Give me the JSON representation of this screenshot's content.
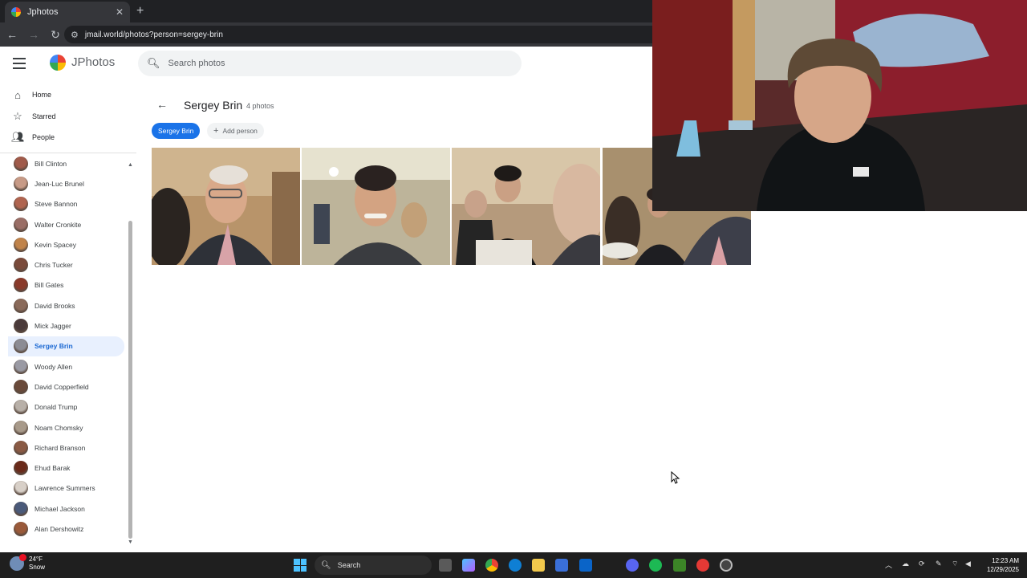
{
  "browser": {
    "tab_title": "Jphotos",
    "tab_close": "✕",
    "new_tab": "+",
    "url": "jmail.world/photos?person=sergey-brin"
  },
  "app": {
    "name": "JPhotos",
    "search_placeholder": "Search photos"
  },
  "nav": [
    {
      "label": "Home",
      "icon": "home-icon"
    },
    {
      "label": "Starred",
      "icon": "star-icon"
    },
    {
      "label": "People",
      "icon": "people-icon"
    }
  ],
  "people": [
    {
      "name": "Bill Clinton",
      "color": "#a05a4a"
    },
    {
      "name": "Jean-Luc Brunel",
      "color": "#c79a86"
    },
    {
      "name": "Steve Bannon",
      "color": "#b0644f"
    },
    {
      "name": "Walter Cronkite",
      "color": "#9a6e66"
    },
    {
      "name": "Kevin Spacey",
      "color": "#c0834a"
    },
    {
      "name": "Chris Tucker",
      "color": "#7a4a3a"
    },
    {
      "name": "Bill Gates",
      "color": "#8a3a2a"
    },
    {
      "name": "David Brooks",
      "color": "#8a6a5a"
    },
    {
      "name": "Mick Jagger",
      "color": "#4a3a3a"
    },
    {
      "name": "Sergey Brin",
      "color": "#8c8c94"
    },
    {
      "name": "Woody Allen",
      "color": "#9a9aa4"
    },
    {
      "name": "David Copperfield",
      "color": "#6a4a3a"
    },
    {
      "name": "Donald Trump",
      "color": "#b8b0a8"
    },
    {
      "name": "Noam Chomsky",
      "color": "#a89a8a"
    },
    {
      "name": "Richard Branson",
      "color": "#8a5a44"
    },
    {
      "name": "Ehud Barak",
      "color": "#6a2a1a"
    },
    {
      "name": "Lawrence Summers",
      "color": "#d8d0c8"
    },
    {
      "name": "Michael Jackson",
      "color": "#4a5a7a"
    },
    {
      "name": "Alan Dershowitz",
      "color": "#9a5a3a"
    }
  ],
  "active_person": "Sergey Brin",
  "album": {
    "title": "Sergey Brin",
    "count_label": "4 photos",
    "chip_active": "Sergey Brin",
    "chip_add": "Add person"
  },
  "taskbar": {
    "weather_temp": "24°F",
    "weather_desc": "Snow",
    "search_label": "Search",
    "time": "12:23 AM",
    "date": "12/29/2025"
  }
}
